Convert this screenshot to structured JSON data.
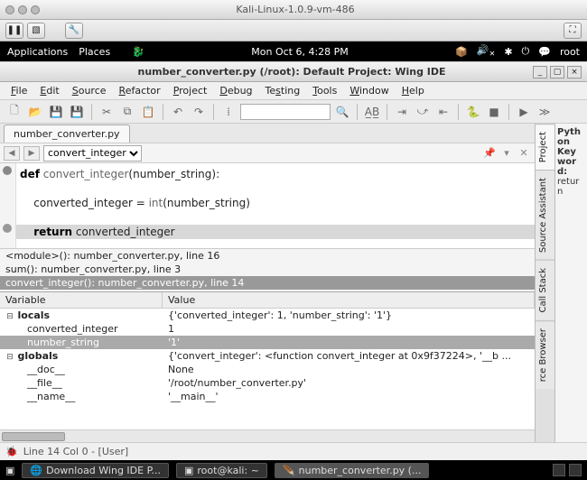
{
  "vm": {
    "title": "Kali-Linux-1.0.9-vm-486"
  },
  "kali": {
    "applications": "Applications",
    "places": "Places",
    "clock": "Mon Oct 6,  4:28 PM",
    "user": "root"
  },
  "window": {
    "title": "number_converter.py (/root): Default Project: Wing IDE"
  },
  "menu": {
    "file": "File",
    "edit": "Edit",
    "source": "Source",
    "refactor": "Refactor",
    "project": "Project",
    "debug": "Debug",
    "testing": "Testing",
    "tools": "Tools",
    "window": "Window",
    "help": "Help"
  },
  "file_tab": "number_converter.py",
  "func_selector": "convert_integer",
  "code": {
    "l1": "def convert_integer(number_string):",
    "l2": "",
    "l3": "    converted_integer = int(number_string)",
    "l4": "",
    "l5": "    return converted_integer"
  },
  "stack": {
    "s1": "<module>(): number_converter.py, line 16",
    "s2": "sum(): number_converter.py, line 3",
    "s3": "convert_integer(): number_converter.py, line 14"
  },
  "vars": {
    "header_var": "Variable",
    "header_val": "Value",
    "locals_label": "locals",
    "locals_val": "{'converted_integer': 1, 'number_string': '1'}",
    "ci_label": "converted_integer",
    "ci_val": "1",
    "ns_label": "number_string",
    "ns_val": "'1'",
    "globals_label": "globals",
    "globals_val": "{'convert_integer': <function convert_integer at 0x9f37224>, '__b ...",
    "doc_label": "__doc__",
    "doc_val": "None",
    "file_label": "__file__",
    "file_val": "'/root/number_converter.py'",
    "name_label": "__name__",
    "name_val": "'__main__'"
  },
  "side": {
    "project": "Project",
    "source_assistant": "Source Assistant",
    "call_stack": "Call Stack",
    "rce_browser": "rce Browser",
    "keyword_title": "Python Keyword:",
    "keyword_val": "return"
  },
  "status": "Line 14 Col 0 - [User]",
  "taskbar": {
    "t1": "Download Wing IDE P...",
    "t2": "root@kali: ~",
    "t3": "number_converter.py (..."
  }
}
